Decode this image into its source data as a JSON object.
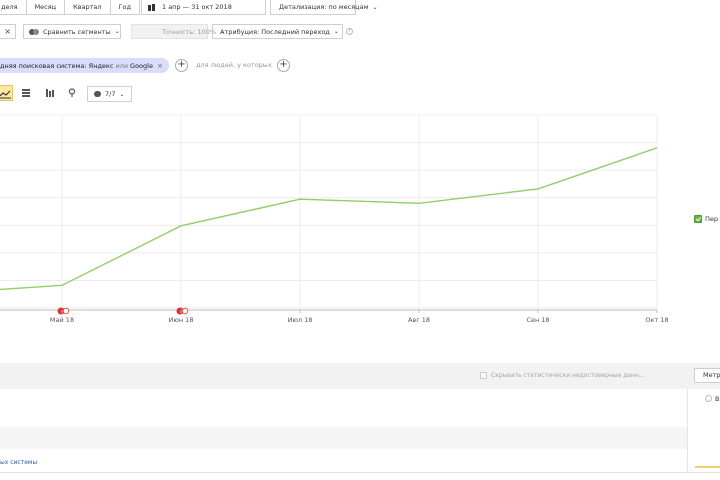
{
  "toolbar": {
    "periods": [
      "деля",
      "Месяц",
      "Квартал",
      "Год"
    ],
    "date_range": "1 апр — 31 окт 2018",
    "detail": "Детализация: по месяцам"
  },
  "filters": {
    "close_glyph": "×",
    "compare_segments": "Сравнить сегменты",
    "accuracy": "Точность: 100%",
    "attribution": "Атрибуция: Последний переход",
    "info_glyph": "?"
  },
  "segment": {
    "prefix": "дняя поисковая система:",
    "value1": "Яндекс",
    "or": "или",
    "value2": "Google",
    "close_glyph": "×",
    "add_glyph": "+",
    "people_text": "для людей, у которых"
  },
  "chart_controls": {
    "compare_count": "7/7"
  },
  "chart_data": {
    "type": "line",
    "categories": [
      "Май 18",
      "Июн 18",
      "Июл 18",
      "Авг 18",
      "Сен 18",
      "Окт 18"
    ],
    "series": [
      {
        "name": "Пер",
        "color": "#8fcf6a",
        "values": [
          7,
          36,
          49,
          47,
          54,
          74
        ]
      }
    ],
    "start_value": 5,
    "ylim": [
      -5,
      90
    ],
    "grid": true,
    "legend": "right",
    "annotation_categories": [
      "Май 18",
      "Июн 18"
    ]
  },
  "legend": {
    "label": "Пер"
  },
  "table": {
    "hide_unreliable": "Скрывать статистически недостоверные данн...",
    "metrics_button": "Метр",
    "radio_label": "В",
    "link_text": "ых системы"
  }
}
